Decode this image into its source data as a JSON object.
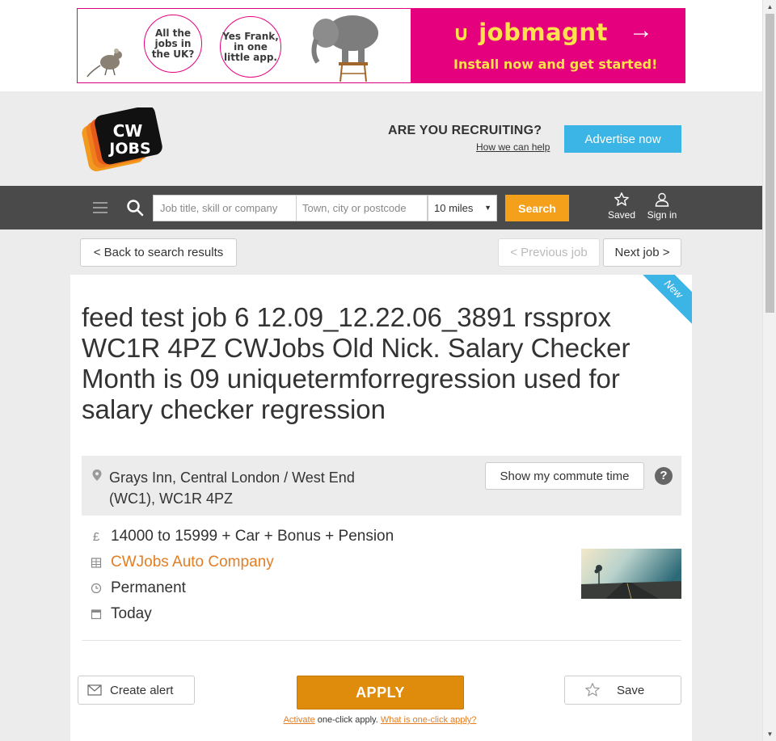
{
  "ad": {
    "bubble1": "All the jobs in the UK?",
    "bubble2": "Yes Frank, in one little app.",
    "brand": "jobmagnt",
    "tagline": "Install now and get started!"
  },
  "header": {
    "logo_text_1": "CW",
    "logo_text_2": "JOBS",
    "recruiting_title": "ARE YOU RECRUITING?",
    "recruiting_link": "How we can help",
    "advertise_label": "Advertise now"
  },
  "search": {
    "job_placeholder": "Job title, skill or company",
    "location_placeholder": "Town, city or postcode",
    "distance": "10 miles",
    "search_label": "Search",
    "saved_label": "Saved",
    "signin_label": "Sign in"
  },
  "pager": {
    "back_label": "< Back to search results",
    "prev_label": "< Previous job",
    "next_label": "Next job >"
  },
  "job": {
    "badge": "New",
    "title": "feed test job 6 12.09_12.22.06_3891 rssprox WC1R 4PZ CWJobs Old Nick. Salary Checker Month is 09 uniquetermforregression used for salary checker regression",
    "location": "Grays Inn, Central London / West End (WC1), WC1R 4PZ",
    "commute_label": "Show my commute time",
    "help_glyph": "?",
    "salary": "14000 to 15999 + Car + Bonus + Pension",
    "company": "CWJobs Auto Company",
    "type": "Permanent",
    "posted": "Today",
    "salary_glyph": "£"
  },
  "actions": {
    "create_alert_label": "Create alert",
    "apply_label": "APPLY",
    "save_label": "Save",
    "activate_link": "Activate",
    "oneclick_text": " one-click apply. ",
    "what_link": "What is one-click apply?"
  },
  "colors": {
    "accent_orange": "#f5a01a",
    "apply_orange": "#df8b0b",
    "advertise_blue": "#3ab5e6",
    "nav_bg": "#4a4a4a",
    "ad_pink": "#e5007e",
    "ad_yellow": "#ffe14d"
  }
}
